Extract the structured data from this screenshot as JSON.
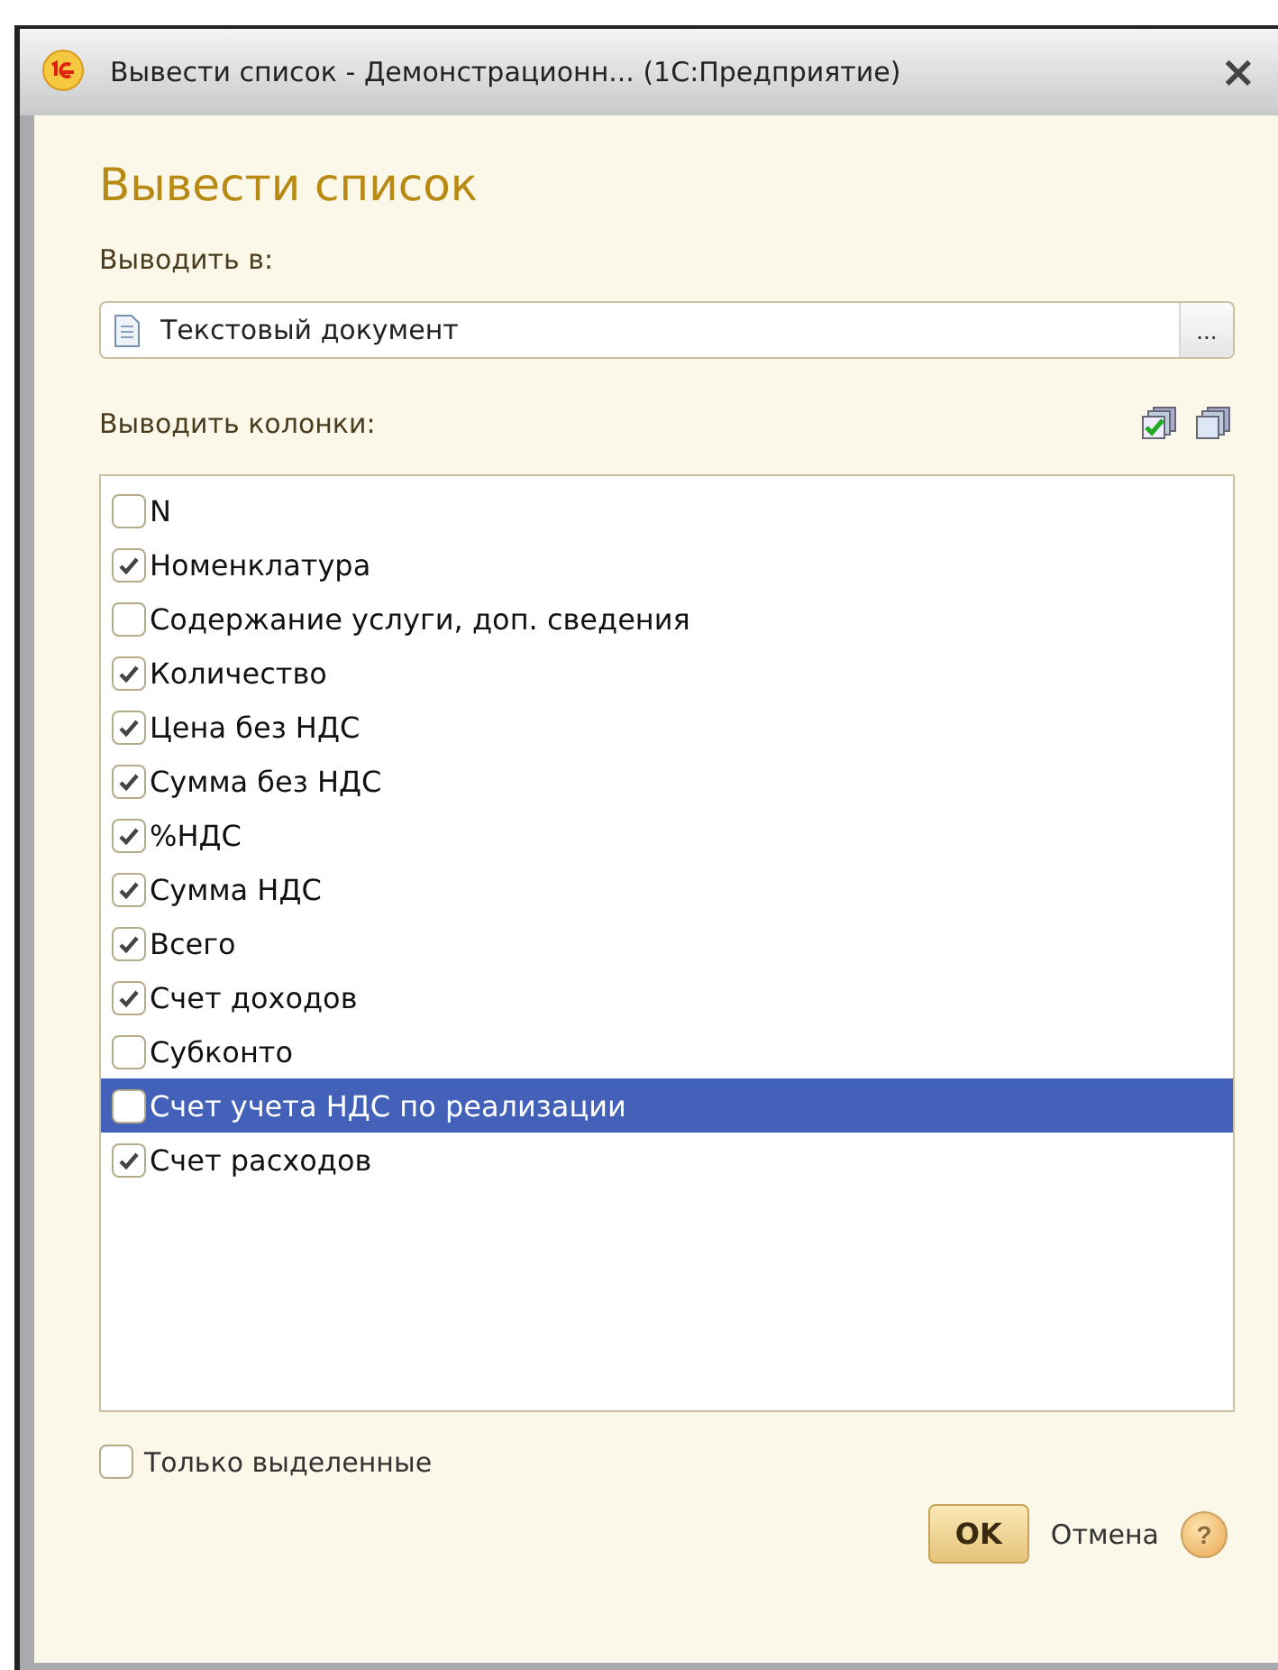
{
  "window": {
    "title": "Вывести список - Демонстрационн...  (1С:Предприятие)",
    "close": "×"
  },
  "heading": "Вывести список",
  "output_to": {
    "label": "Выводить в:",
    "value": "Текстовый документ",
    "button": "..."
  },
  "columns_label": "Выводить колонки:",
  "columns": [
    {
      "label": "N",
      "checked": false,
      "selected": false
    },
    {
      "label": "Номенклатура",
      "checked": true,
      "selected": false
    },
    {
      "label": "Содержание услуги, доп. сведения",
      "checked": false,
      "selected": false
    },
    {
      "label": "Количество",
      "checked": true,
      "selected": false
    },
    {
      "label": "Цена без НДС",
      "checked": true,
      "selected": false
    },
    {
      "label": "Сумма без НДС",
      "checked": true,
      "selected": false
    },
    {
      "label": "%НДС",
      "checked": true,
      "selected": false
    },
    {
      "label": "Сумма НДС",
      "checked": true,
      "selected": false
    },
    {
      "label": "Всего",
      "checked": true,
      "selected": false
    },
    {
      "label": "Счет доходов",
      "checked": true,
      "selected": false
    },
    {
      "label": "Субконто",
      "checked": false,
      "selected": false
    },
    {
      "label": "Счет учета НДС по реализации",
      "checked": false,
      "selected": true
    },
    {
      "label": "Счет расходов",
      "checked": true,
      "selected": false
    }
  ],
  "only_selected": {
    "label": "Только выделенные",
    "checked": false
  },
  "buttons": {
    "ok": "OK",
    "cancel": "Отмена",
    "help": "?"
  }
}
